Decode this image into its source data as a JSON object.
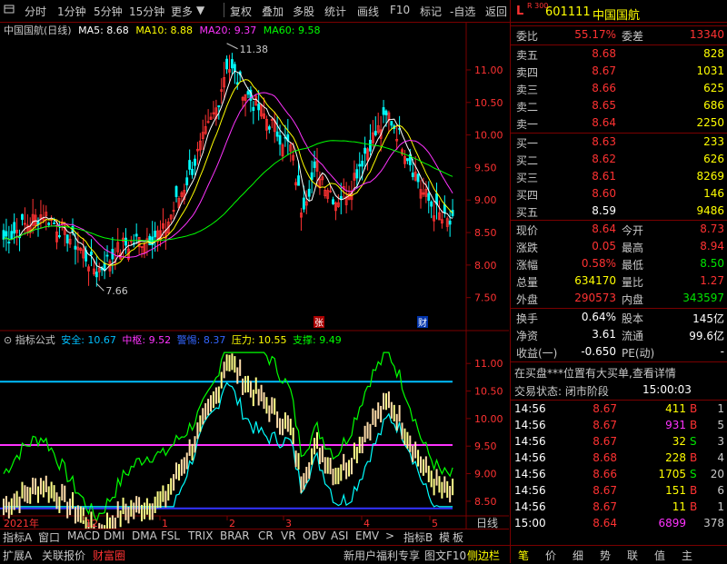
{
  "toolbar": {
    "left": [
      "分时",
      "1分钟",
      "5分钟",
      "15分钟",
      "更多"
    ],
    "right": [
      "复权",
      "叠加",
      "多股",
      "统计",
      "画线",
      "F10",
      "标记",
      "-自选",
      "返回"
    ]
  },
  "main": {
    "stock_name": "中国国航",
    "period": "(日线)",
    "ma5": "MA5: 8.68",
    "ma10": "MA10: 8.88",
    "ma20": "MA20: 9.37",
    "ma60": "MA60: 9.58",
    "high_label": "11.38",
    "low_label": "7.66",
    "marker_zhang": "张",
    "marker_cai": "财",
    "y_ticks": [
      "11.00",
      "10.50",
      "10.00",
      "9.50",
      "9.00",
      "8.50",
      "8.00",
      "7.50"
    ]
  },
  "indicator": {
    "name": "指标公式",
    "safe": "安全: 10.67",
    "center": "中枢: 9.52",
    "warn": "警惕: 8.37",
    "pressure": "压力: 10.55",
    "support": "支撑: 9.49",
    "y_ticks": [
      "11.00",
      "10.50",
      "10.00",
      "9.50",
      "9.00",
      "8.50"
    ]
  },
  "xaxis": {
    "labels": [
      "2021年",
      "12",
      "1",
      "2",
      "3",
      "4",
      "5"
    ],
    "period_btn": "日线"
  },
  "tabs": {
    "items": [
      "指标A",
      "窗口",
      "MACD",
      "DMI",
      "DMA",
      "FSL",
      "TRIX",
      "BRAR",
      "CR",
      "VR",
      "OBV",
      "ASI",
      "EMV"
    ],
    "more": ">",
    "right": [
      "指标B",
      "模",
      "板"
    ]
  },
  "status": {
    "items": [
      "扩展A",
      "关联报价",
      "财富圈"
    ],
    "marquee": "新用户福利专享",
    "f10": "图文F10",
    "sidebar": "侧边栏",
    "icons": [
      "笔",
      "价",
      "细",
      "势",
      "联",
      "值",
      "主"
    ]
  },
  "quote": {
    "code_prefix": "L",
    "code_sub": "R 300",
    "code": "601111",
    "name": "中国国航",
    "weibi_label": "委比",
    "weibi": "55.17%",
    "weicha_label": "委差",
    "weicha": "13340",
    "asks": [
      {
        "label": "卖五",
        "price": "8.68",
        "vol": "828"
      },
      {
        "label": "卖四",
        "price": "8.67",
        "vol": "1031"
      },
      {
        "label": "卖三",
        "price": "8.66",
        "vol": "625"
      },
      {
        "label": "卖二",
        "price": "8.65",
        "vol": "686"
      },
      {
        "label": "卖一",
        "price": "8.64",
        "vol": "2250"
      }
    ],
    "bids": [
      {
        "label": "买一",
        "price": "8.63",
        "vol": "233"
      },
      {
        "label": "买二",
        "price": "8.62",
        "vol": "626"
      },
      {
        "label": "买三",
        "price": "8.61",
        "vol": "8269"
      },
      {
        "label": "买四",
        "price": "8.60",
        "vol": "146"
      },
      {
        "label": "买五",
        "price": "8.59",
        "vol": "9486"
      }
    ],
    "stats": [
      {
        "l1": "现价",
        "v1": "8.64",
        "l2": "今开",
        "v2": "8.73"
      },
      {
        "l1": "涨跌",
        "v1": "0.05",
        "l2": "最高",
        "v2": "8.94"
      },
      {
        "l1": "涨幅",
        "v1": "0.58%",
        "l2": "最低",
        "v2": "8.50"
      },
      {
        "l1": "总量",
        "v1": "634170",
        "l2": "量比",
        "v2": "1.27"
      },
      {
        "l1": "外盘",
        "v1": "290573",
        "l2": "内盘",
        "v2": "343597"
      }
    ],
    "stats2": [
      {
        "l1": "换手",
        "v1": "0.64%",
        "l2": "股本",
        "v2": "145亿"
      },
      {
        "l1": "净资",
        "v1": "3.61",
        "l2": "流通",
        "v2": "99.6亿"
      },
      {
        "l1": "收益(一)",
        "v1": "-0.650",
        "l2": "PE(动)",
        "v2": "-"
      }
    ],
    "notice": "在买盘***位置有大买单,查看详情",
    "trade_status_label": "交易状态: 闭市阶段",
    "trade_status_time": "15:00:03",
    "ticks": [
      {
        "t": "14:56",
        "p": "8.67",
        "v": "411",
        "s": "B"
      },
      {
        "t": "14:56",
        "p": "8.67",
        "v": "931",
        "s": "B"
      },
      {
        "t": "14:56",
        "p": "8.67",
        "v": "32",
        "s": "S"
      },
      {
        "t": "14:56",
        "p": "8.68",
        "v": "228",
        "s": "B"
      },
      {
        "t": "14:56",
        "p": "8.66",
        "v": "1705",
        "s": "S"
      },
      {
        "t": "14:56",
        "p": "8.67",
        "v": "151",
        "s": "B"
      },
      {
        "t": "14:56",
        "p": "8.67",
        "v": "11",
        "s": "B"
      },
      {
        "t": "15:00",
        "p": "8.64",
        "v": "6899",
        "s": ""
      }
    ],
    "tick_counts": [
      "1",
      "5",
      "3",
      "4",
      "20",
      "6",
      "1",
      "378"
    ]
  },
  "colors": {
    "up": "#ff3232",
    "down": "#00e600",
    "ma5": "#ffffff",
    "ma10": "#ffff00",
    "ma20": "#ff33ff",
    "ma60": "#00ff00"
  }
}
